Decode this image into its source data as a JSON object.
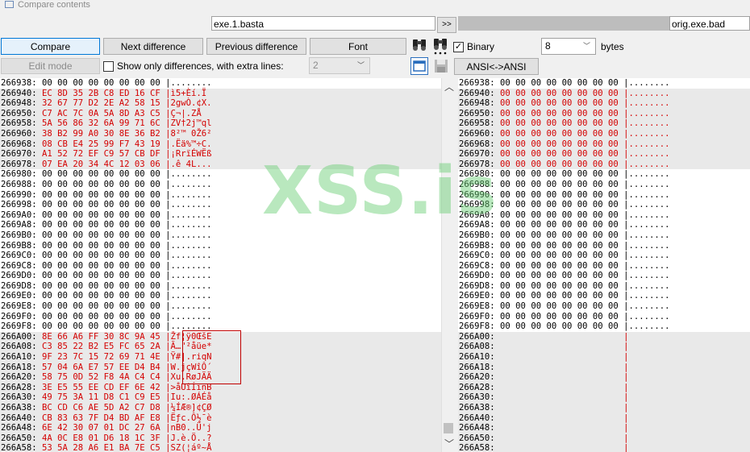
{
  "window": {
    "title": "Compare contents"
  },
  "toolbar": {
    "left_file": "exe.1.basta",
    "swap_label": ">>",
    "right_file": "orig.exe.bad",
    "compare_label": "Compare",
    "next_diff_label": "Next difference",
    "prev_diff_label": "Previous difference",
    "font_label": "Font",
    "binary_label": "Binary",
    "binary_checked": "✓",
    "bytes_value": "8",
    "bytes_label": "bytes",
    "edit_mode_label": "Edit mode",
    "show_only_label": "Show only differences, with extra lines:",
    "extra_lines_value": "2",
    "ansi_label": "ANSI<->ANSI",
    "scroll_up": "︿",
    "scroll_down": "﹀"
  },
  "watermark": "XSS.is",
  "left_rows": [
    {
      "addr": "266938:",
      "hex": "00 00 00 00 00 00 00 00",
      "asc": "|........",
      "diff": false
    },
    {
      "addr": "266940:",
      "hex": "EC 8D 35 2B C8 ED 16 CF",
      "asc": "|ì5+Èí.Ï",
      "diff": true
    },
    {
      "addr": "266948:",
      "hex": "32 67 77 D2 2E A2 58 15",
      "asc": "|2gwÒ.¢X.",
      "diff": true
    },
    {
      "addr": "266950:",
      "hex": "C7 AC 7C 0A 5A 8D A3 C5",
      "asc": "|Ç¬|.ZÅ",
      "diff": true
    },
    {
      "addr": "266958:",
      "hex": "5A 56 86 32 6A 99 71 6C",
      "asc": "|ZV†2j™ql",
      "diff": true
    },
    {
      "addr": "266960:",
      "hex": "38 B2 99 A0 30 8E 36 B2",
      "asc": "|8²™ 0Ž6²",
      "diff": true
    },
    {
      "addr": "266968:",
      "hex": "08 CB E4 25 99 F7 43 19",
      "asc": "|.Ëä%™÷C.",
      "diff": true
    },
    {
      "addr": "266970:",
      "hex": "A1 52 72 EF C9 57 CB DF",
      "asc": "|¡RrïÉWËß",
      "diff": true
    },
    {
      "addr": "266978:",
      "hex": "07 EA 20 34 4C 12 03 06",
      "asc": "|.ê 4L...",
      "diff": true
    },
    {
      "addr": "266980:",
      "hex": "00 00 00 00 00 00 00 00",
      "asc": "|........",
      "diff": false
    },
    {
      "addr": "266988:",
      "hex": "00 00 00 00 00 00 00 00",
      "asc": "|........",
      "diff": false
    },
    {
      "addr": "266990:",
      "hex": "00 00 00 00 00 00 00 00",
      "asc": "|........",
      "diff": false
    },
    {
      "addr": "266998:",
      "hex": "00 00 00 00 00 00 00 00",
      "asc": "|........",
      "diff": false
    },
    {
      "addr": "2669A0:",
      "hex": "00 00 00 00 00 00 00 00",
      "asc": "|........",
      "diff": false
    },
    {
      "addr": "2669A8:",
      "hex": "00 00 00 00 00 00 00 00",
      "asc": "|........",
      "diff": false
    },
    {
      "addr": "2669B0:",
      "hex": "00 00 00 00 00 00 00 00",
      "asc": "|........",
      "diff": false
    },
    {
      "addr": "2669B8:",
      "hex": "00 00 00 00 00 00 00 00",
      "asc": "|........",
      "diff": false
    },
    {
      "addr": "2669C0:",
      "hex": "00 00 00 00 00 00 00 00",
      "asc": "|........",
      "diff": false
    },
    {
      "addr": "2669C8:",
      "hex": "00 00 00 00 00 00 00 00",
      "asc": "|........",
      "diff": false
    },
    {
      "addr": "2669D0:",
      "hex": "00 00 00 00 00 00 00 00",
      "asc": "|........",
      "diff": false
    },
    {
      "addr": "2669D8:",
      "hex": "00 00 00 00 00 00 00 00",
      "asc": "|........",
      "diff": false
    },
    {
      "addr": "2669E0:",
      "hex": "00 00 00 00 00 00 00 00",
      "asc": "|........",
      "diff": false
    },
    {
      "addr": "2669E8:",
      "hex": "00 00 00 00 00 00 00 00",
      "asc": "|........",
      "diff": false
    },
    {
      "addr": "2669F0:",
      "hex": "00 00 00 00 00 00 00 00",
      "asc": "|........",
      "diff": false
    },
    {
      "addr": "2669F8:",
      "hex": "00 00 00 00 00 00 00 00",
      "asc": "|........",
      "diff": false
    },
    {
      "addr": "266A00:",
      "hex": "8E 66 A6 FF 30 8C 9A 45",
      "asc": "|Žf¦ÿ0ŒšE",
      "diff": true
    },
    {
      "addr": "266A08:",
      "hex": "C3 85 22 B2 E5 FC 65 2A",
      "asc": "|Ã…\"²åüe*",
      "diff": true
    },
    {
      "addr": "266A10:",
      "hex": "9F 23 7C 15 72 69 71 4E",
      "asc": "|Ÿ#|.riqN",
      "diff": true
    },
    {
      "addr": "266A18:",
      "hex": "57 04 6A E7 57 EE D4 B4",
      "asc": "|W.jçWîÔ´",
      "diff": true
    },
    {
      "addr": "266A20:",
      "hex": "58 75 0D 52 F8 4A C4 C4",
      "asc": "|Xu.RøJÄÄ",
      "diff": true
    },
    {
      "addr": "266A28:",
      "hex": "3E E5 55 EE CD EF 6E 42",
      "asc": "|>åUîÍïnB",
      "diff": true
    },
    {
      "addr": "266A30:",
      "hex": "49 75 3A 11 D8 C1 C9 E5",
      "asc": "|Iu:.ØÁÉå",
      "diff": true
    },
    {
      "addr": "266A38:",
      "hex": "BC CD C6 AE 5D A2 C7 D8",
      "asc": "|¼ÍÆ®]¢ÇØ",
      "diff": true
    },
    {
      "addr": "266A40:",
      "hex": "CB 83 63 7F D4 BD AF E8",
      "asc": "|Ëƒc.Ô½¯è",
      "diff": true
    },
    {
      "addr": "266A48:",
      "hex": "6E 42 30 07 01 DC 27 6A",
      "asc": "|nB0..Ü'j",
      "diff": true
    },
    {
      "addr": "266A50:",
      "hex": "4A 0C E8 01 D6 18 1C 3F",
      "asc": "|J.è.Ö..?",
      "diff": true
    },
    {
      "addr": "266A58:",
      "hex": "53 5A 28 A6 E1 BA 7E C5",
      "asc": "|SZ(¦áº~Å",
      "diff": true
    }
  ],
  "right_rows": [
    {
      "addr": "266938:",
      "hex": "00 00 00 00 00 00 00 00",
      "asc": "|........",
      "diff": false
    },
    {
      "addr": "266940:",
      "hex": "00 00 00 00 00 00 00 00",
      "asc": "|........",
      "diff": true
    },
    {
      "addr": "266948:",
      "hex": "00 00 00 00 00 00 00 00",
      "asc": "|........",
      "diff": true
    },
    {
      "addr": "266950:",
      "hex": "00 00 00 00 00 00 00 00",
      "asc": "|........",
      "diff": true
    },
    {
      "addr": "266958:",
      "hex": "00 00 00 00 00 00 00 00",
      "asc": "|........",
      "diff": true
    },
    {
      "addr": "266960:",
      "hex": "00 00 00 00 00 00 00 00",
      "asc": "|........",
      "diff": true
    },
    {
      "addr": "266968:",
      "hex": "00 00 00 00 00 00 00 00",
      "asc": "|........",
      "diff": true
    },
    {
      "addr": "266970:",
      "hex": "00 00 00 00 00 00 00 00",
      "asc": "|........",
      "diff": true
    },
    {
      "addr": "266978:",
      "hex": "00 00 00 00 00 00 00 00",
      "asc": "|........",
      "diff": true
    },
    {
      "addr": "266980:",
      "hex": "00 00 00 00 00 00 00 00",
      "asc": "|........",
      "diff": false
    },
    {
      "addr": "266988:",
      "hex": "00 00 00 00 00 00 00 00",
      "asc": "|........",
      "diff": false
    },
    {
      "addr": "266990:",
      "hex": "00 00 00 00 00 00 00 00",
      "asc": "|........",
      "diff": false
    },
    {
      "addr": "266998:",
      "hex": "00 00 00 00 00 00 00 00",
      "asc": "|........",
      "diff": false
    },
    {
      "addr": "2669A0:",
      "hex": "00 00 00 00 00 00 00 00",
      "asc": "|........",
      "diff": false
    },
    {
      "addr": "2669A8:",
      "hex": "00 00 00 00 00 00 00 00",
      "asc": "|........",
      "diff": false
    },
    {
      "addr": "2669B0:",
      "hex": "00 00 00 00 00 00 00 00",
      "asc": "|........",
      "diff": false
    },
    {
      "addr": "2669B8:",
      "hex": "00 00 00 00 00 00 00 00",
      "asc": "|........",
      "diff": false
    },
    {
      "addr": "2669C0:",
      "hex": "00 00 00 00 00 00 00 00",
      "asc": "|........",
      "diff": false
    },
    {
      "addr": "2669C8:",
      "hex": "00 00 00 00 00 00 00 00",
      "asc": "|........",
      "diff": false
    },
    {
      "addr": "2669D0:",
      "hex": "00 00 00 00 00 00 00 00",
      "asc": "|........",
      "diff": false
    },
    {
      "addr": "2669D8:",
      "hex": "00 00 00 00 00 00 00 00",
      "asc": "|........",
      "diff": false
    },
    {
      "addr": "2669E0:",
      "hex": "00 00 00 00 00 00 00 00",
      "asc": "|........",
      "diff": false
    },
    {
      "addr": "2669E8:",
      "hex": "00 00 00 00 00 00 00 00",
      "asc": "|........",
      "diff": false
    },
    {
      "addr": "2669F0:",
      "hex": "00 00 00 00 00 00 00 00",
      "asc": "|........",
      "diff": false
    },
    {
      "addr": "2669F8:",
      "hex": "00 00 00 00 00 00 00 00",
      "asc": "|........",
      "diff": false
    },
    {
      "addr": "266A00:",
      "hex": "                       ",
      "asc": "|",
      "diff": true
    },
    {
      "addr": "266A08:",
      "hex": "                       ",
      "asc": "|",
      "diff": true
    },
    {
      "addr": "266A10:",
      "hex": "                       ",
      "asc": "|",
      "diff": true
    },
    {
      "addr": "266A18:",
      "hex": "                       ",
      "asc": "|",
      "diff": true
    },
    {
      "addr": "266A20:",
      "hex": "                       ",
      "asc": "|",
      "diff": true
    },
    {
      "addr": "266A28:",
      "hex": "                       ",
      "asc": "|",
      "diff": true
    },
    {
      "addr": "266A30:",
      "hex": "                       ",
      "asc": "|",
      "diff": true
    },
    {
      "addr": "266A38:",
      "hex": "                       ",
      "asc": "|",
      "diff": true
    },
    {
      "addr": "266A40:",
      "hex": "                       ",
      "asc": "|",
      "diff": true
    },
    {
      "addr": "266A48:",
      "hex": "                       ",
      "asc": "|",
      "diff": true
    },
    {
      "addr": "266A50:",
      "hex": "                       ",
      "asc": "|",
      "diff": true
    },
    {
      "addr": "266A58:",
      "hex": "                       ",
      "asc": "|",
      "diff": true
    }
  ]
}
